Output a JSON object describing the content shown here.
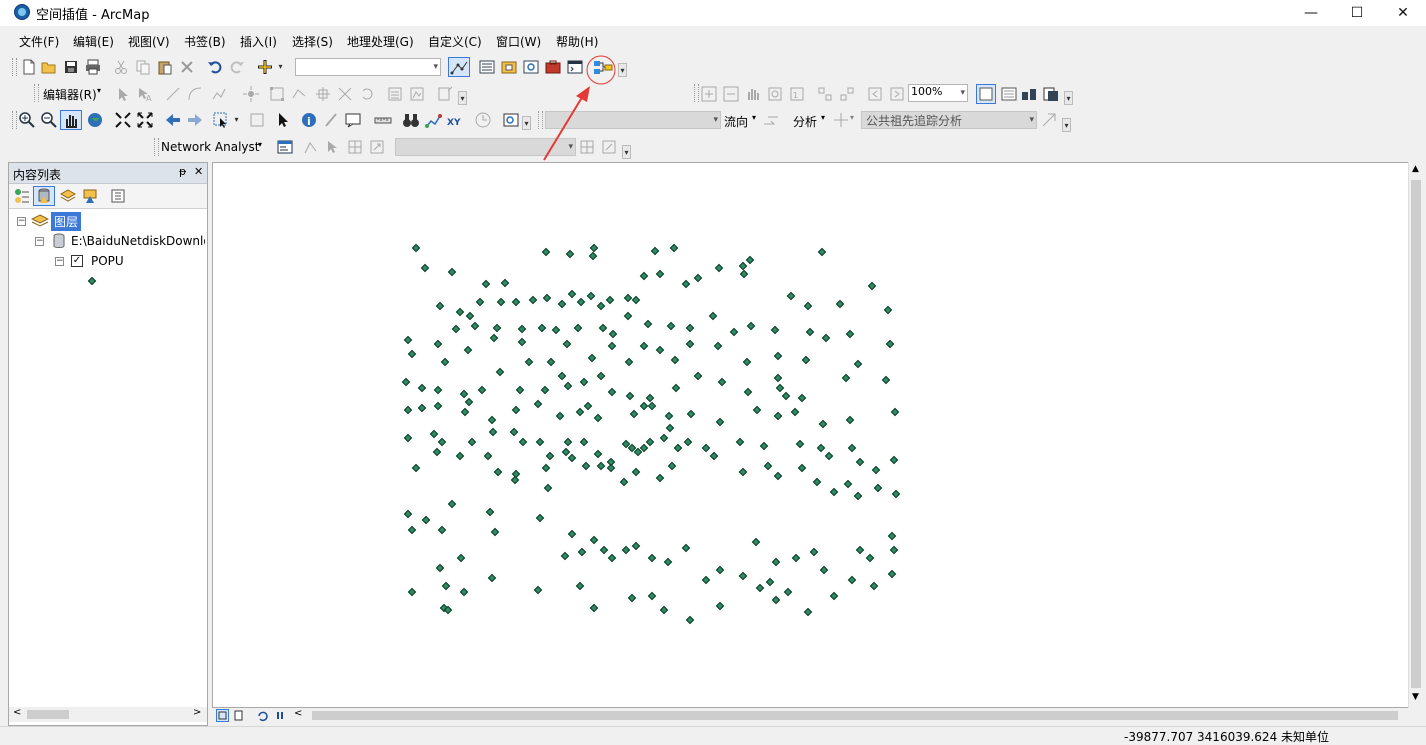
{
  "window": {
    "title": "空间插值 - ArcMap",
    "minimize": "—",
    "maximize": "☐",
    "close": "✕"
  },
  "menu": [
    {
      "name": "menu-file",
      "label": "文件(F)"
    },
    {
      "name": "menu-edit",
      "label": "编辑(E)"
    },
    {
      "name": "menu-view",
      "label": "视图(V)"
    },
    {
      "name": "menu-bookmarks",
      "label": "书签(B)"
    },
    {
      "name": "menu-insert",
      "label": "插入(I)"
    },
    {
      "name": "menu-selection",
      "label": "选择(S)"
    },
    {
      "name": "menu-geoprocessing",
      "label": "地理处理(G)"
    },
    {
      "name": "menu-customize",
      "label": "自定义(C)"
    },
    {
      "name": "menu-windows",
      "label": "窗口(W)"
    },
    {
      "name": "menu-help",
      "label": "帮助(H)"
    }
  ],
  "toolbar": {
    "editor_label": "编辑器(R)",
    "zoom_value": "100%",
    "flow_label": "流向",
    "analysis_label": "分析",
    "trace_combo_value": "公共祖先追踪分析",
    "network_analyst_label": "Network Analyst",
    "scale_value": ""
  },
  "toc": {
    "title": "内容列表",
    "pin_icon": "ᵽ",
    "close_icon": "✕",
    "layers_label": "图层",
    "source_path": "E:\\BaiduNetdiskDownlo",
    "layer_name": "POPU",
    "layer_checked": "✓"
  },
  "status": {
    "coords": "-39877.707  3416039.624 未知单位"
  },
  "colors": {
    "point_fill": "#2f8a63",
    "selection_blue": "#3b78d8",
    "annotation_red": "#e53935"
  }
}
